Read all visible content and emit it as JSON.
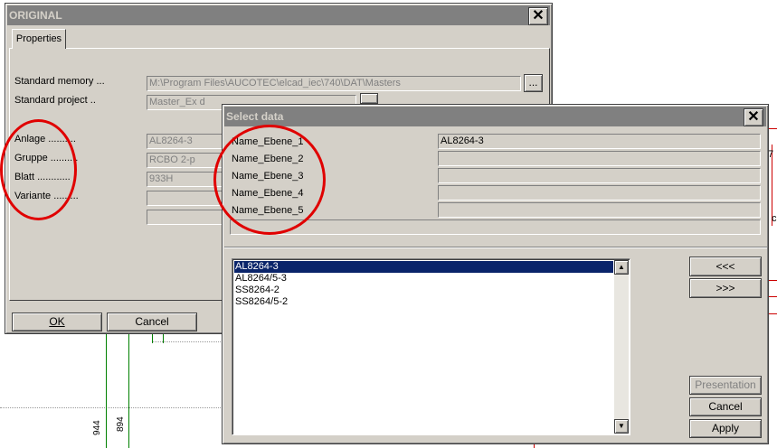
{
  "original_dialog": {
    "title": "ORIGINAL",
    "tab": "Properties",
    "fields": [
      {
        "label": "Standard memory ...",
        "value": "M:\\Program Files\\AUCOTEC\\elcad_iec\\740\\DAT\\Masters"
      },
      {
        "label": "Standard project ..",
        "value": "Master_Ex d"
      }
    ],
    "browse_label": "...",
    "level_fields": [
      {
        "label": "Anlage ..........",
        "value": "AL8264-3"
      },
      {
        "label": "Gruppe ..........",
        "value": "RCBO 2-p"
      },
      {
        "label": "Blatt ............",
        "value": "933H"
      },
      {
        "label": "Variante .........",
        "value": ""
      }
    ],
    "ok_label": "OK",
    "cancel_label": "Cancel"
  },
  "select_dialog": {
    "title": "Select data",
    "rows": [
      {
        "label": "Name_Ebene_1",
        "value": "AL8264-3"
      },
      {
        "label": "Name_Ebene_2",
        "value": ""
      },
      {
        "label": "Name_Ebene_3",
        "value": ""
      },
      {
        "label": "Name_Ebene_4",
        "value": ""
      },
      {
        "label": "Name_Ebene_5",
        "value": ""
      }
    ],
    "list_items": [
      "AL8264-3",
      "AL8264/5-3",
      "SS8264-2",
      "SS8264/5-2"
    ],
    "selected_index": 0,
    "prev_label": "<<<",
    "next_label": ">>>",
    "presentation_label": "Presentation",
    "cancel_label": "Cancel",
    "apply_label": "Apply"
  },
  "background": {
    "vertical_labels": [
      "944",
      "894"
    ],
    "side_chars": [
      "7",
      "c"
    ]
  },
  "colors": {
    "dialog_face": "#d4d0c8",
    "inactive_title": "#808080",
    "selection": "#0a246a",
    "annotation_red": "#e00000",
    "drawing_red": "#cc0000",
    "drawing_green": "#008000"
  }
}
